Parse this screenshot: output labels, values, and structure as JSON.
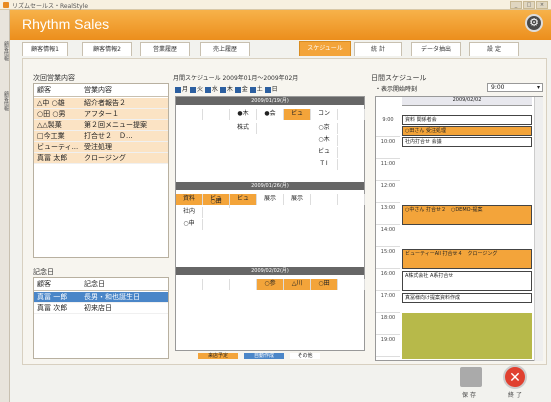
{
  "window": {
    "title": "リズムセールス・RealStyle",
    "buttons": [
      "_",
      "□",
      "×"
    ]
  },
  "brand": "Rhythm Sales",
  "lefttabs": [
    "顧客情報",
    "顧客情報"
  ],
  "tabs": [
    {
      "label": "顧客情報1",
      "active": false
    },
    {
      "label": "顧客情報2",
      "active": false
    },
    {
      "label": "営業履歴",
      "active": false
    },
    {
      "label": "売上履歴",
      "active": false
    },
    {
      "label": "スケジュール",
      "active": true
    },
    {
      "label": "統 計",
      "active": false
    },
    {
      "label": "データ抽出",
      "active": false
    },
    {
      "label": "設 定",
      "active": false
    }
  ],
  "next_sales": {
    "title": "次回営業内容",
    "headers": [
      "顧客",
      "営業内容"
    ],
    "rows": [
      [
        "△中 ○雄",
        "紹介者報告２"
      ],
      [
        "○田 ○男",
        "アフター１"
      ],
      [
        "△△製菓",
        "第２回メニュー提案"
      ],
      [
        "□今工業",
        "打合せ２　Ｄ..."
      ],
      [
        "ビューティ...",
        "受注処理"
      ],
      [
        "真冨 太郎",
        "クロージング"
      ]
    ]
  },
  "anniversary": {
    "title": "記念日",
    "headers": [
      "顧客",
      "記念日"
    ],
    "rows": [
      {
        "c": "真冨 一郎",
        "d": "長男・和也誕生日",
        "sel": true
      },
      {
        "c": "真冨 次郎",
        "d": "初来店日",
        "sel": false
      }
    ]
  },
  "monthly": {
    "title": "月間スケジュール 2009年01月～2009年02月",
    "days": [
      "月",
      "火",
      "水",
      "木",
      "金",
      "土",
      "日"
    ],
    "weeks": [
      "2009/01/19(月)",
      "2009/01/26(月)",
      "2009/02/02(月)"
    ],
    "cells": [
      [
        {
          "t": "",
          "bg": ""
        },
        {
          "t": "",
          "bg": ""
        },
        {
          "t": "●木",
          "bg": "#fff"
        },
        {
          "t": "●会",
          "bg": "#fff"
        },
        {
          "t": "ビュ",
          "bg": "#f3a43a"
        },
        {
          "t": "コン",
          "bg": "#fff"
        },
        {
          "t": "",
          "bg": ""
        }
      ],
      [
        {
          "t": "資料",
          "bg": "#f3a43a"
        },
        {
          "t": "ビュ",
          "bg": "#f3a43a"
        },
        {
          "t": "ビュ",
          "bg": "#f3a43a"
        },
        {
          "t": "展示",
          "bg": "#fff"
        },
        {
          "t": "展示",
          "bg": "#fff"
        },
        {
          "t": "",
          "bg": ""
        },
        {
          "t": "",
          "bg": ""
        }
      ],
      [
        {
          "t": "",
          "bg": ""
        },
        {
          "t": "",
          "bg": ""
        },
        {
          "t": "",
          "bg": ""
        },
        {
          "t": "○参",
          "bg": "#f3a43a"
        },
        {
          "t": "△川",
          "bg": "#f3a43a"
        },
        {
          "t": "○田",
          "bg": "#f3a43a"
        },
        {
          "t": "",
          "bg": ""
        }
      ]
    ],
    "extras": [
      "株式",
      "○田",
      "社内",
      "○申",
      "○京",
      "○木",
      "ビュ",
      "T I"
    ],
    "legend": [
      {
        "l": "来店予定",
        "c": "#f3a43a"
      },
      {
        "l": "自動作成",
        "c": "#4b86c8"
      },
      {
        "l": "その他",
        "c": "#fff"
      }
    ]
  },
  "daily": {
    "title": "日間スケジュール",
    "start_label": "・表示開始時刻",
    "start_value": "9:00",
    "date": "2009/02/02",
    "times": [
      "9:00",
      "10:00",
      "11:00",
      "12:00",
      "13:00",
      "14:00",
      "15:00",
      "16:00",
      "17:00",
      "18:00",
      "19:00"
    ],
    "appts": [
      {
        "t": "資料 関係者会",
        "bg": "#fff"
      },
      {
        "t": "○田さん 受注処理",
        "bg": "#f3a43a"
      },
      {
        "t": "社内打合せ 会議",
        "bg": "#fff"
      },
      {
        "t": "○中さん 打合せ２　○DEMO-提案",
        "bg": "#f3a43a"
      },
      {
        "t": "ビューティーAll 打合せ４　クロージング",
        "bg": "#f3a43a"
      },
      {
        "t": "A株式会社 A系打合せ",
        "bg": "#fff"
      },
      {
        "t": "真冨様向け提案資料作成",
        "bg": "#fff"
      }
    ]
  },
  "footer": {
    "save": "保 存",
    "exit": "終 了"
  }
}
